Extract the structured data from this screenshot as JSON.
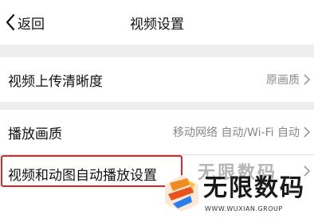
{
  "nav": {
    "back_label": "返回",
    "title": "视频设置"
  },
  "rows": [
    {
      "label": "视频上传清晰度",
      "value": "原画质"
    },
    {
      "label": "播放画质",
      "value": "移动网络 自动/Wi-Fi 自动"
    },
    {
      "label": "视频和动图自动播放设置",
      "value": ""
    }
  ],
  "watermark": {
    "title": "无限数码",
    "subtitle": "WWW.WUXIAN.GROUP"
  },
  "colors": {
    "highlight": "#e02424",
    "background": "#eeeeee"
  }
}
